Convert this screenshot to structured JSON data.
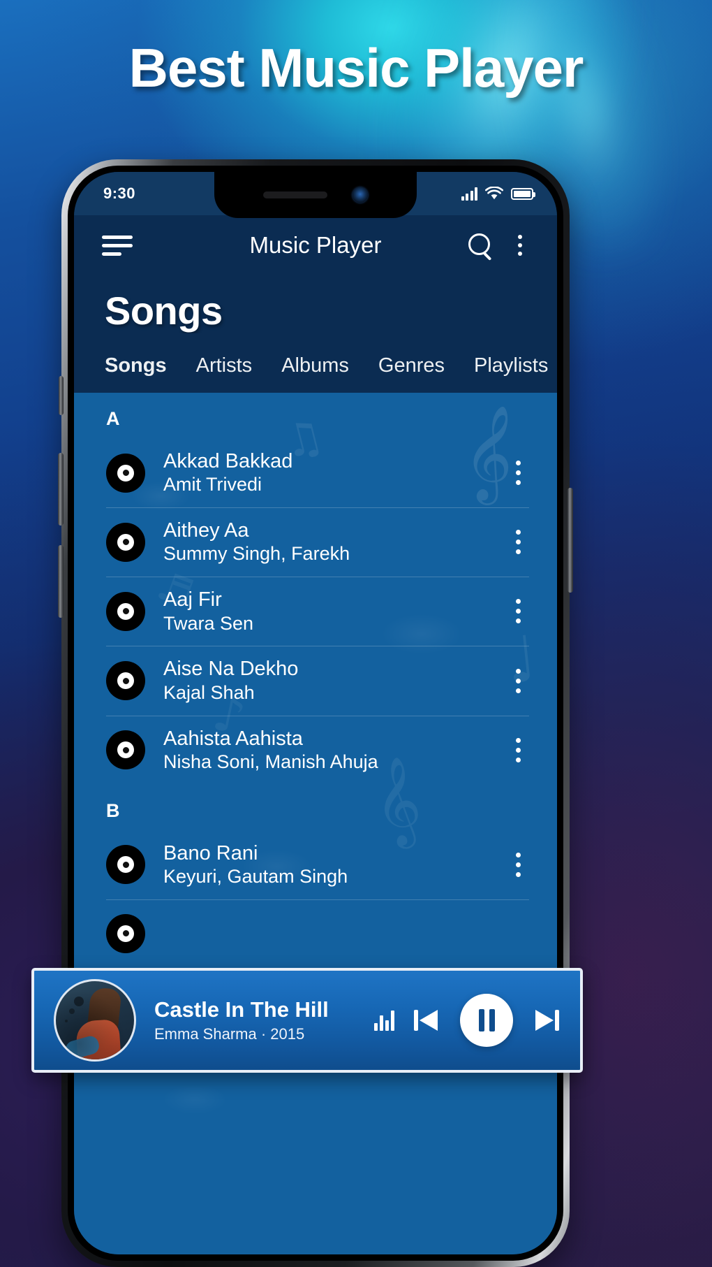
{
  "headline": "Best Music Player",
  "status_bar": {
    "time": "9:30",
    "signal_icon": "signal-bars-icon",
    "wifi_icon": "wifi-icon",
    "battery_icon": "battery-full-icon"
  },
  "appbar": {
    "menu_icon": "hamburger-menu-icon",
    "title": "Music Player",
    "search_icon": "search-icon",
    "overflow_icon": "more-vertical-icon"
  },
  "page": {
    "title": "Songs"
  },
  "tabs": [
    {
      "label": "Songs",
      "active": true
    },
    {
      "label": "Artists",
      "active": false
    },
    {
      "label": "Albums",
      "active": false
    },
    {
      "label": "Genres",
      "active": false
    },
    {
      "label": "Playlists",
      "active": false
    }
  ],
  "sections": [
    {
      "letter": "A",
      "songs": [
        {
          "title": "Akkad Bakkad",
          "artist": "Amit Trivedi"
        },
        {
          "title": "Aithey Aa",
          "artist": "Summy Singh, Farekh"
        },
        {
          "title": "Aaj Fir",
          "artist": "Twara Sen"
        },
        {
          "title": "Aise Na Dekho",
          "artist": "Kajal Shah"
        },
        {
          "title": "Aahista Aahista",
          "artist": "Nisha Soni, Manish Ahuja"
        }
      ]
    },
    {
      "letter": "B",
      "songs": [
        {
          "title": "Bano Rani",
          "artist": "Keyuri, Gautam Singh"
        }
      ]
    }
  ],
  "now_playing": {
    "title": "Castle In The Hill",
    "subtitle": "Emma Sharma · 2015",
    "album_art": "singer-photo",
    "equalizer_icon": "equalizer-icon",
    "previous_icon": "skip-previous-icon",
    "play_pause_icon": "pause-icon",
    "next_icon": "skip-next-icon"
  },
  "colors": {
    "appbar_navy": "#0b2c52",
    "list_blue": "#13619f",
    "player_blue": "#1768b6",
    "accent_white": "#ffffff"
  }
}
